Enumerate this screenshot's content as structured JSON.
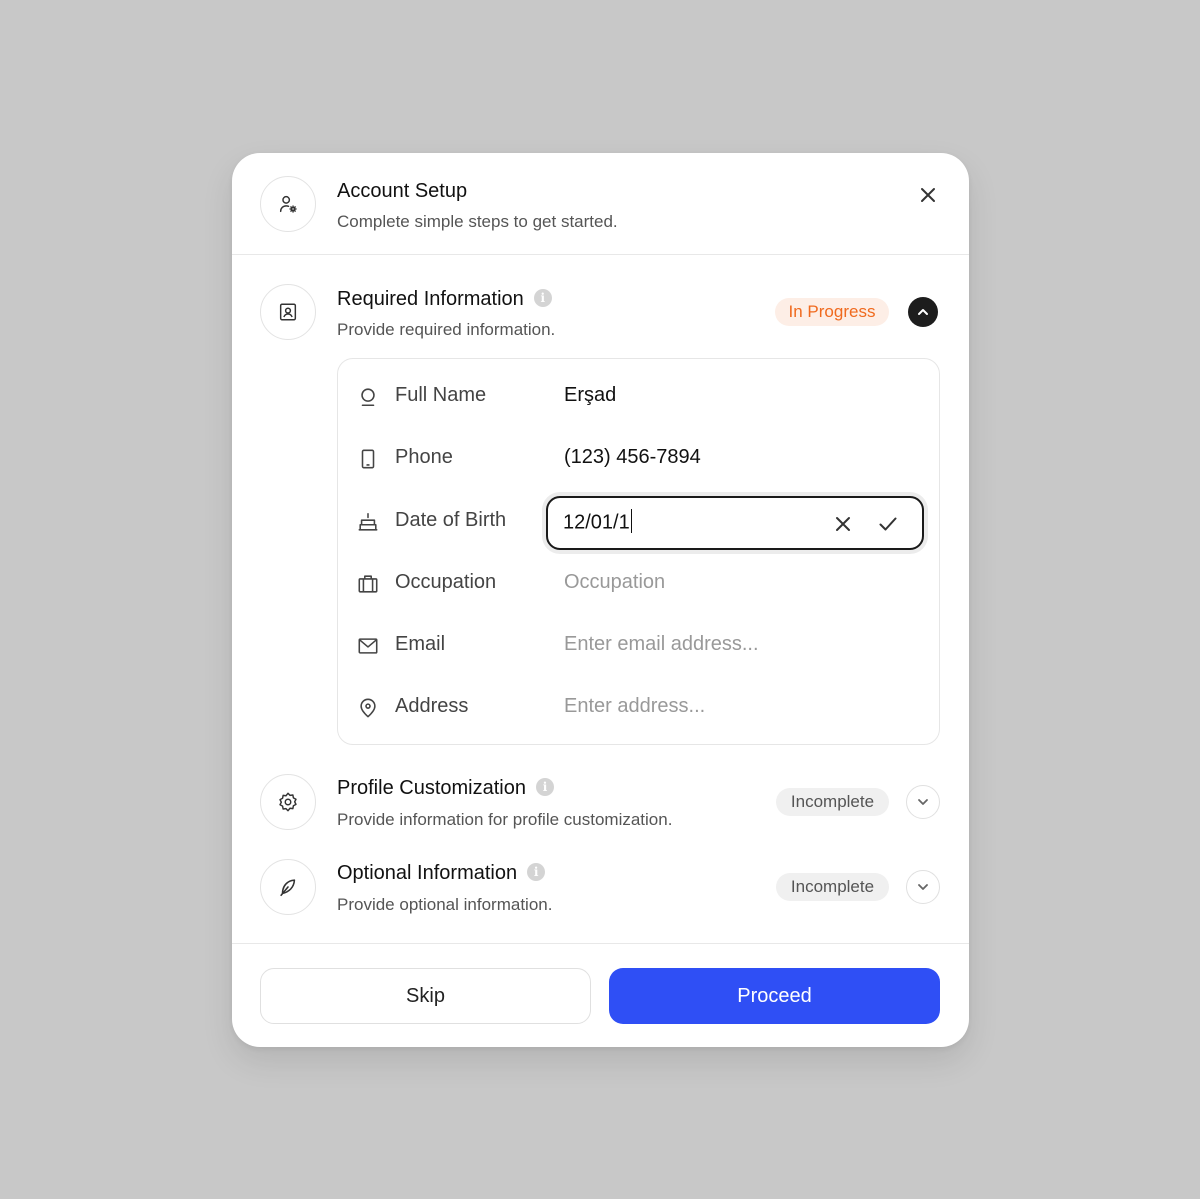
{
  "header": {
    "title": "Account Setup",
    "subtitle": "Complete simple steps to get started.",
    "icon": "user-gear-icon",
    "close_icon": "close-icon"
  },
  "sections": [
    {
      "title": "Required Information",
      "subtitle": "Provide required information.",
      "icon": "id-card-icon",
      "status": "In Progress",
      "expanded": true
    },
    {
      "title": "Profile Customization",
      "subtitle": "Provide information for profile customization.",
      "icon": "gear-icon",
      "status": "Incomplete",
      "expanded": false
    },
    {
      "title": "Optional Information",
      "subtitle": "Provide optional information.",
      "icon": "feather-icon",
      "status": "Incomplete",
      "expanded": false
    }
  ],
  "fields": [
    {
      "label": "Full Name",
      "icon": "user-icon",
      "value": "Erşad",
      "placeholder": ""
    },
    {
      "label": "Phone",
      "icon": "phone-icon",
      "value": "(123) 456-7894",
      "placeholder": ""
    },
    {
      "label": "Date of Birth",
      "icon": "cake-icon",
      "value": "12/01/1",
      "placeholder": "",
      "editing": true
    },
    {
      "label": "Occupation",
      "icon": "briefcase-icon",
      "value": "",
      "placeholder": "Occupation"
    },
    {
      "label": "Email",
      "icon": "mail-icon",
      "value": "",
      "placeholder": "Enter email address..."
    },
    {
      "label": "Address",
      "icon": "location-pin-icon",
      "value": "",
      "placeholder": "Enter address..."
    }
  ],
  "footer": {
    "skip_label": "Skip",
    "proceed_label": "Proceed"
  },
  "colors": {
    "accent": "#2f4ff5",
    "in_progress": "#f06a1e",
    "in_progress_bg": "#fdeee6",
    "incomplete_bg": "#f0f0f0"
  }
}
